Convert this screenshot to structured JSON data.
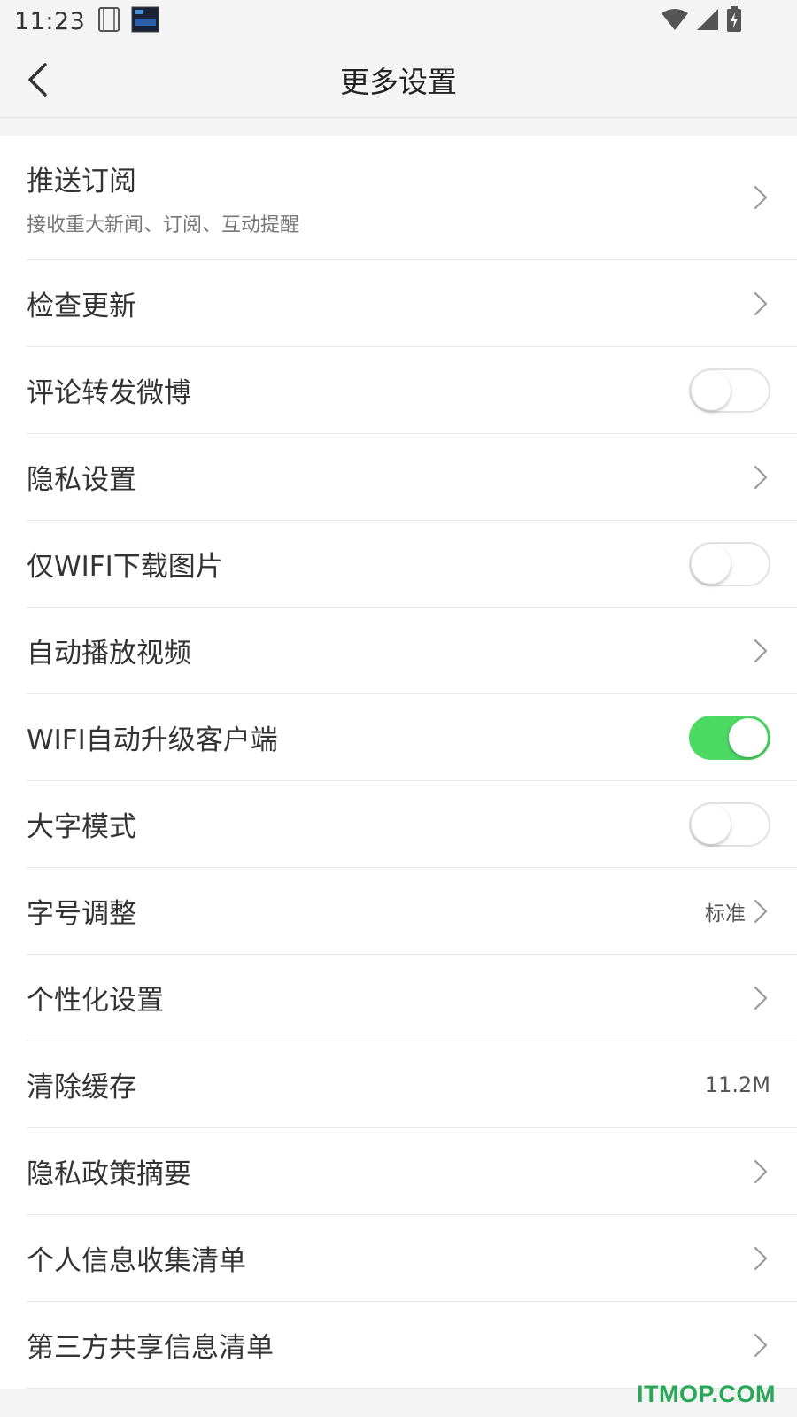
{
  "status_bar": {
    "time": "11:23"
  },
  "header": {
    "title": "更多设置"
  },
  "settings": [
    {
      "label": "推送订阅",
      "sub": "接收重大新闻、订阅、互动提醒",
      "control": "chevron"
    },
    {
      "label": "检查更新",
      "control": "chevron"
    },
    {
      "label": "评论转发微博",
      "control": "toggle",
      "on": false
    },
    {
      "label": "隐私设置",
      "control": "chevron"
    },
    {
      "label": "仅WIFI下载图片",
      "control": "toggle",
      "on": false
    },
    {
      "label": "自动播放视频",
      "control": "chevron"
    },
    {
      "label": "WIFI自动升级客户端",
      "control": "toggle",
      "on": true
    },
    {
      "label": "大字模式",
      "control": "toggle",
      "on": false
    },
    {
      "label": "字号调整",
      "value": "标准",
      "control": "chevron"
    },
    {
      "label": "个性化设置",
      "control": "chevron"
    },
    {
      "label": "清除缓存",
      "value": "11.2M",
      "control": "none"
    },
    {
      "label": "隐私政策摘要",
      "control": "chevron"
    },
    {
      "label": "个人信息收集清单",
      "control": "chevron"
    },
    {
      "label": "第三方共享信息清单",
      "control": "chevron"
    }
  ],
  "watermark": "ITMOP.COM",
  "colors": {
    "toggle_on": "#4cd964",
    "watermark": "#2aa85a"
  }
}
